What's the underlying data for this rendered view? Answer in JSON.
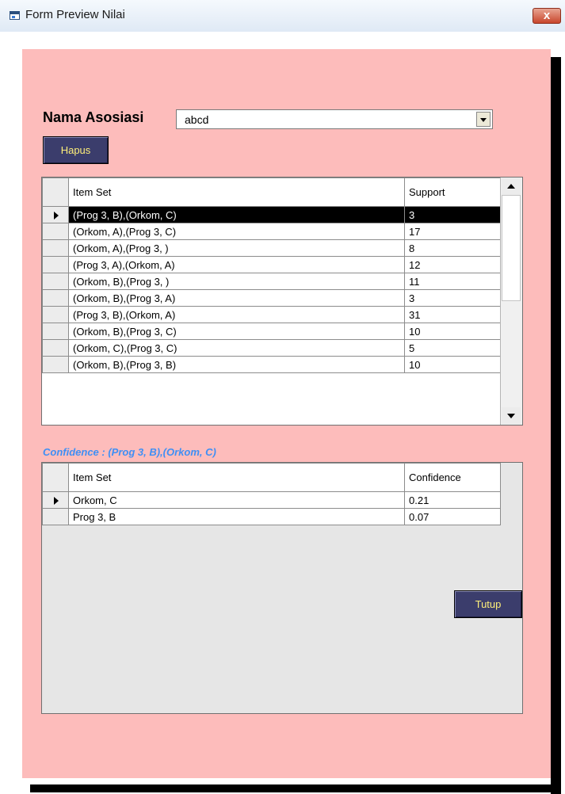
{
  "window": {
    "title": "Form Preview Nilai",
    "close_label": "x"
  },
  "form": {
    "nama_label": "Nama Asosiasi",
    "nama_value": "abcd",
    "hapus_label": "Hapus",
    "tutup_label": "Tutup"
  },
  "support_grid": {
    "headers": [
      "Item Set",
      "Support"
    ],
    "rows": [
      {
        "item": "(Prog 3, B),(Orkom, C)",
        "value": "3"
      },
      {
        "item": "(Orkom, A),(Prog 3, C)",
        "value": "17"
      },
      {
        "item": "(Orkom, A),(Prog 3, )",
        "value": "8"
      },
      {
        "item": "(Prog 3, A),(Orkom, A)",
        "value": "12"
      },
      {
        "item": "(Orkom, B),(Prog 3, )",
        "value": "11"
      },
      {
        "item": "(Orkom, B),(Prog 3, A)",
        "value": "3"
      },
      {
        "item": "(Prog 3, B),(Orkom, A)",
        "value": "31"
      },
      {
        "item": "(Orkom, B),(Prog 3, C)",
        "value": "10"
      },
      {
        "item": "(Orkom, C),(Prog 3, C)",
        "value": "5"
      },
      {
        "item": "(Orkom, B),(Prog 3, B)",
        "value": "10"
      }
    ]
  },
  "confidence_label": "Confidence : (Prog 3, B),(Orkom, C)",
  "confidence_grid": {
    "headers": [
      "Item Set",
      "Confidence"
    ],
    "rows": [
      {
        "item": "Orkom, C",
        "value": "0.21"
      },
      {
        "item": "Prog 3, B",
        "value": "0.07"
      }
    ]
  },
  "colors": {
    "panel_bg": "#fdbcbb",
    "button_bg": "#3b3d6c",
    "button_text": "#ffef7a",
    "confidence_label": "#3f8ff5"
  }
}
